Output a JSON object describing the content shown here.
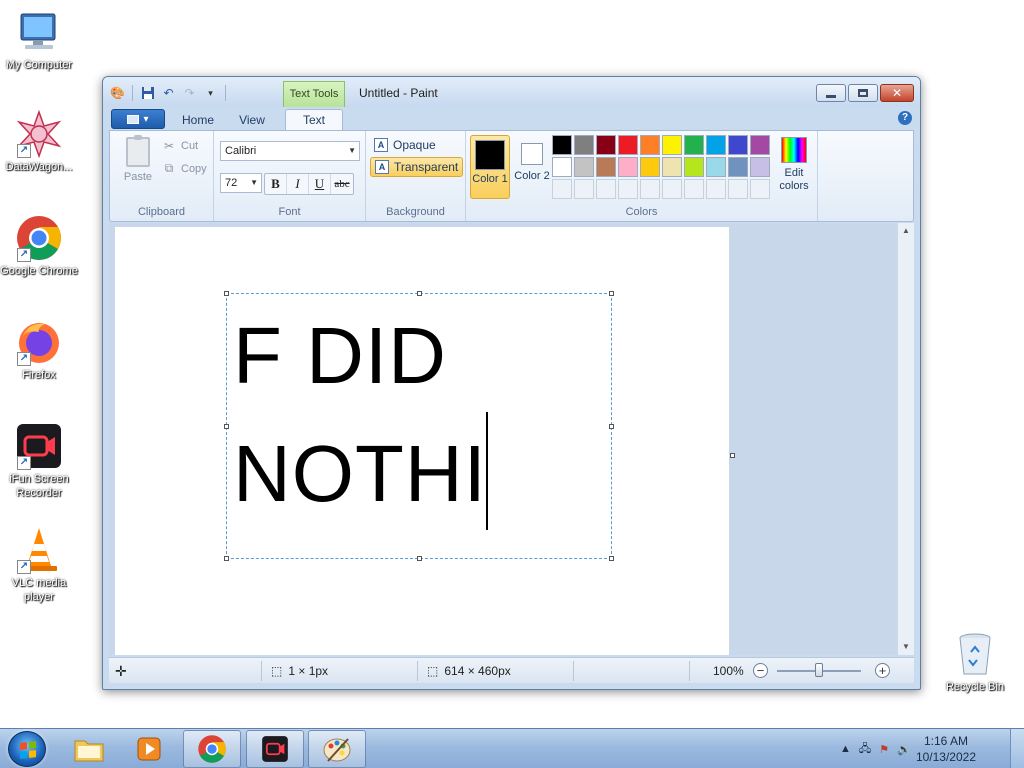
{
  "desktop": {
    "icons": [
      {
        "label": "My Computer"
      },
      {
        "label": "DataWagon..."
      },
      {
        "label": "Google Chrome"
      },
      {
        "label": "Firefox"
      },
      {
        "label": "iFun Screen Recorder"
      },
      {
        "label": "VLC media player"
      },
      {
        "label": "Recycle Bin"
      }
    ]
  },
  "window": {
    "title": "Untitled - Paint",
    "context_tab": "Text Tools"
  },
  "ribbon": {
    "tabs": [
      {
        "label": "Home"
      },
      {
        "label": "View"
      },
      {
        "label": "Text"
      }
    ],
    "clipboard": {
      "group_label": "Clipboard",
      "paste": "Paste",
      "cut": "Cut",
      "copy": "Copy"
    },
    "font": {
      "group_label": "Font",
      "family": "Calibri",
      "size": "72",
      "bold": "B",
      "italic": "I",
      "underline": "U",
      "strikethrough": "abc"
    },
    "background": {
      "group_label": "Background",
      "opaque": "Opaque",
      "transparent": "Transparent",
      "selected": "Transparent"
    },
    "colors": {
      "group_label": "Colors",
      "color1_label": "Color 1",
      "color2_label": "Color 2",
      "color1": "#000000",
      "color2": "#ffffff",
      "edit_colors": "Edit colors",
      "palette": [
        "#000000",
        "#7f7f7f",
        "#880015",
        "#ed1c24",
        "#ff7f27",
        "#fff200",
        "#22b14c",
        "#00a2e8",
        "#3f48cc",
        "#a349a4",
        "#ffffff",
        "#c3c3c3",
        "#b97a57",
        "#ffaec9",
        "#ffc90e",
        "#efe4b0",
        "#b5e61d",
        "#99d9ea",
        "#7092be",
        "#c8bfe7"
      ],
      "empty_slots": 10
    }
  },
  "canvas": {
    "text_lines": [
      "F DID",
      "NOTHI"
    ]
  },
  "statusbar": {
    "selection_size": "1 × 1px",
    "image_size": "614 × 460px",
    "zoom": "100%"
  },
  "taskbar": {
    "clock_time": "1:16 AM",
    "clock_date": "10/13/2022"
  }
}
